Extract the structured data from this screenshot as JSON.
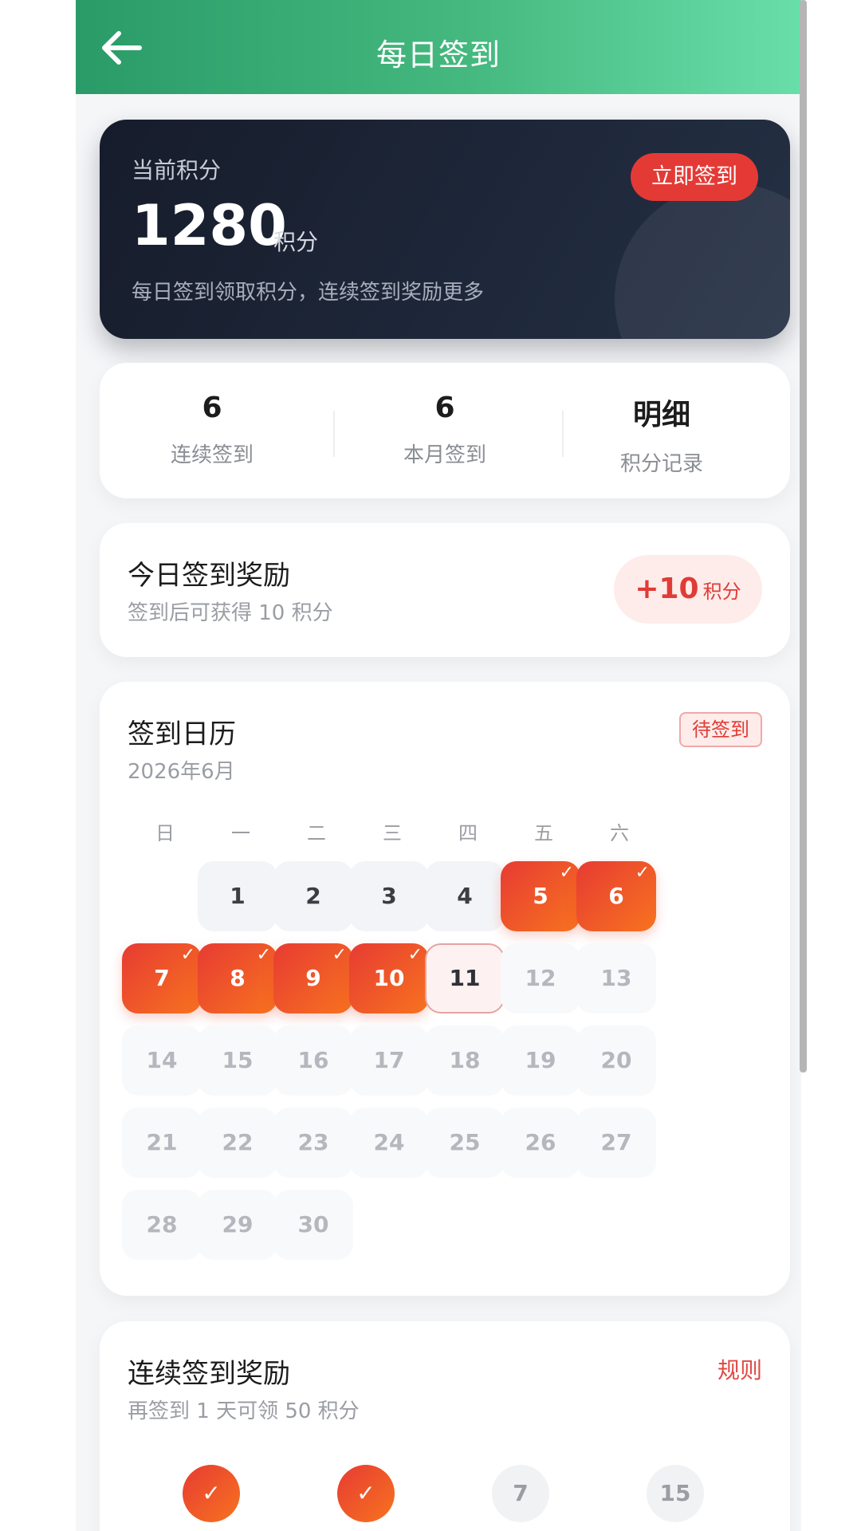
{
  "header": {
    "title": "每日签到",
    "back_icon": "arrow-left-icon"
  },
  "points": {
    "label": "当前积分",
    "value": "1280",
    "unit": "积分",
    "desc": "每日签到领取积分，连续签到奖励更多",
    "checkin_button": "立即签到"
  },
  "stats": [
    {
      "value": "6",
      "label": "连续签到"
    },
    {
      "value": "6",
      "label": "本月签到"
    },
    {
      "value": "明细",
      "label": "积分记录"
    }
  ],
  "today_reward": {
    "title": "今日签到奖励",
    "subtitle": "签到后可获得 10 积分",
    "amount": "+10",
    "unit": "积分"
  },
  "calendar": {
    "title": "签到日历",
    "month": "2026年6月",
    "status": "待签到",
    "weekdays": [
      "日",
      "一",
      "二",
      "三",
      "四",
      "五",
      "六"
    ],
    "first_weekday": 1,
    "days": [
      {
        "d": "1",
        "s": "past"
      },
      {
        "d": "2",
        "s": "past"
      },
      {
        "d": "3",
        "s": "past"
      },
      {
        "d": "4",
        "s": "past"
      },
      {
        "d": "5",
        "s": "signed"
      },
      {
        "d": "6",
        "s": "signed"
      },
      {
        "d": "7",
        "s": "signed"
      },
      {
        "d": "8",
        "s": "signed"
      },
      {
        "d": "9",
        "s": "signed"
      },
      {
        "d": "10",
        "s": "signed"
      },
      {
        "d": "11",
        "s": "today"
      },
      {
        "d": "12",
        "s": "future"
      },
      {
        "d": "13",
        "s": "future"
      },
      {
        "d": "14",
        "s": "future"
      },
      {
        "d": "15",
        "s": "future"
      },
      {
        "d": "16",
        "s": "future"
      },
      {
        "d": "17",
        "s": "future"
      },
      {
        "d": "18",
        "s": "future"
      },
      {
        "d": "19",
        "s": "future"
      },
      {
        "d": "20",
        "s": "future"
      },
      {
        "d": "21",
        "s": "future"
      },
      {
        "d": "22",
        "s": "future"
      },
      {
        "d": "23",
        "s": "future"
      },
      {
        "d": "24",
        "s": "future"
      },
      {
        "d": "25",
        "s": "future"
      },
      {
        "d": "26",
        "s": "future"
      },
      {
        "d": "27",
        "s": "future"
      },
      {
        "d": "28",
        "s": "future"
      },
      {
        "d": "29",
        "s": "future"
      },
      {
        "d": "30",
        "s": "future"
      }
    ],
    "check_glyph": "✓"
  },
  "streak": {
    "title": "连续签到奖励",
    "subtitle": "再签到 1 天可领 50 积分",
    "rules_link": "规则",
    "milestones": [
      {
        "mark": "✓",
        "done": true
      },
      {
        "mark": "✓",
        "done": true
      },
      {
        "mark": "7",
        "done": false
      },
      {
        "mark": "15",
        "done": false
      }
    ]
  },
  "colors": {
    "header_gradient": [
      "#2a9b68",
      "#69dea9"
    ],
    "accent_red": "#e43a36",
    "signed_gradient": [
      "#e73b33",
      "#f7731f"
    ],
    "card_dark": "#161c2b"
  }
}
